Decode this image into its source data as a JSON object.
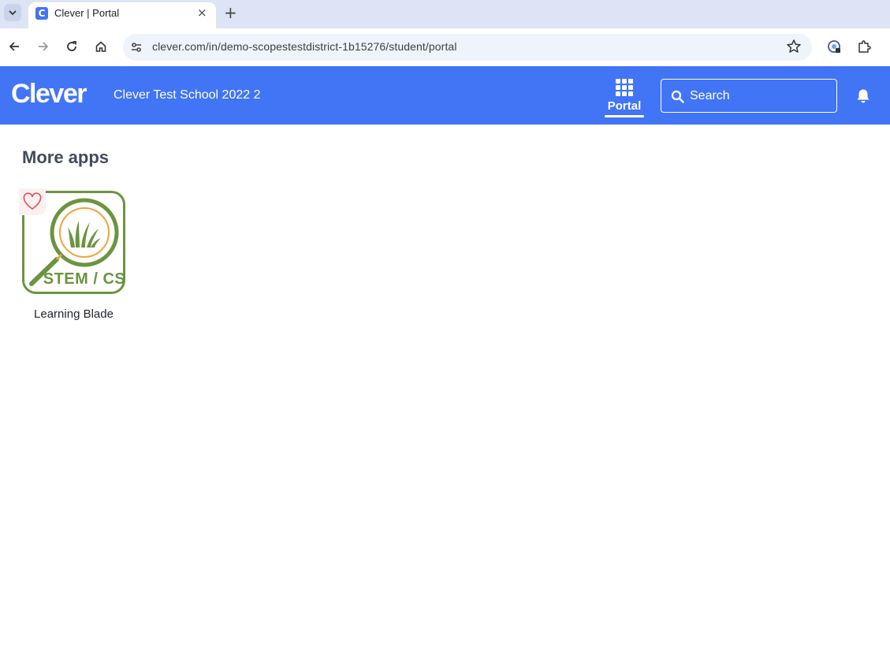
{
  "browser": {
    "tab_title": "Clever | Portal",
    "tab_favicon_letter": "C",
    "tab_close_glyph": "×",
    "new_tab_glyph": "+",
    "url": "clever.com/in/demo-scopestestdistrict-1b15276/student/portal",
    "icons": [
      "tab-search-icon",
      "back-icon",
      "forward-icon",
      "reload-icon",
      "home-icon",
      "site-info-icon",
      "bookmark-star-icon",
      "extension-account-icon",
      "extensions-puzzle-icon"
    ]
  },
  "header": {
    "logo_text": "Clever",
    "school_name": "Clever Test School 2022 2",
    "nav_portal_label": "Portal",
    "search_placeholder": "Search",
    "accent_color": "#4274f6"
  },
  "main": {
    "section_title": "More apps",
    "apps": [
      {
        "name": "Learning Blade",
        "icon_text": "STEM / CS",
        "favorite": false
      }
    ]
  }
}
